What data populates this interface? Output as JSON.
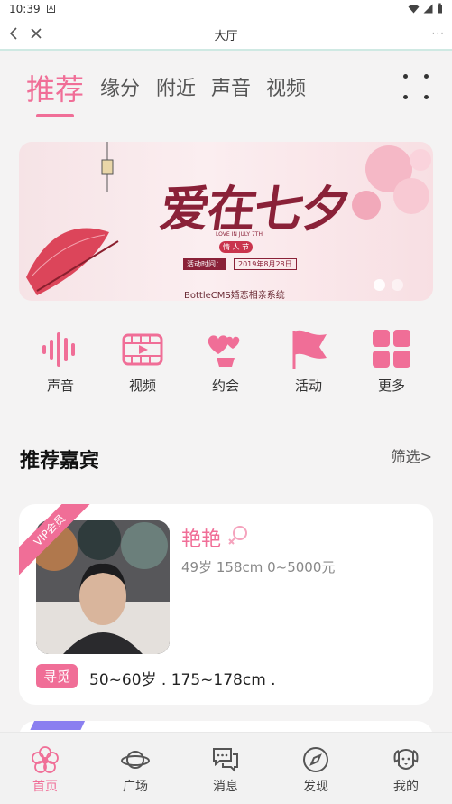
{
  "statusbar": {
    "time": "10:39",
    "notification_glyph": "A"
  },
  "titlebar": {
    "title": "大厅",
    "more": "···"
  },
  "tabs": [
    {
      "label": "推荐",
      "active": true
    },
    {
      "label": "缘分",
      "active": false
    },
    {
      "label": "附近",
      "active": false
    },
    {
      "label": "声音",
      "active": false
    },
    {
      "label": "视频",
      "active": false
    }
  ],
  "banner": {
    "headline": "爱在七夕",
    "subline": "LOVE IN JULY 7TH",
    "tag": "情 人 节",
    "date_label": "活动时间：",
    "date": "2019年8月28日",
    "brand": "BottleCMS婚恋相亲系统",
    "slide_count": 2,
    "active_slide": 1
  },
  "quick_links": [
    {
      "label": "声音",
      "icon": "voice-wave-icon"
    },
    {
      "label": "视频",
      "icon": "video-film-icon"
    },
    {
      "label": "约会",
      "icon": "date-hearts-icon"
    },
    {
      "label": "活动",
      "icon": "flag-icon"
    },
    {
      "label": "更多",
      "icon": "grid-more-icon"
    }
  ],
  "section": {
    "title": "推荐嘉宾",
    "filter": "筛选>"
  },
  "card": {
    "badge": "VIP会员",
    "name": "艳艳",
    "info": "49岁 158cm 0~5000元",
    "seek_label": "寻觅",
    "seek_text": "50~60岁 . 175~178cm ."
  },
  "bottom_nav": [
    {
      "label": "首页",
      "icon": "home-flower-icon",
      "active": true
    },
    {
      "label": "广场",
      "icon": "planet-icon",
      "active": false
    },
    {
      "label": "消息",
      "icon": "chat-bubbles-icon",
      "active": false
    },
    {
      "label": "发现",
      "icon": "compass-icon",
      "active": false
    },
    {
      "label": "我的",
      "icon": "dog-face-icon",
      "active": false
    }
  ],
  "colors": {
    "accent": "#f06e97",
    "title_bar_border": "#cfe9e3",
    "background": "#f4f3f3"
  }
}
